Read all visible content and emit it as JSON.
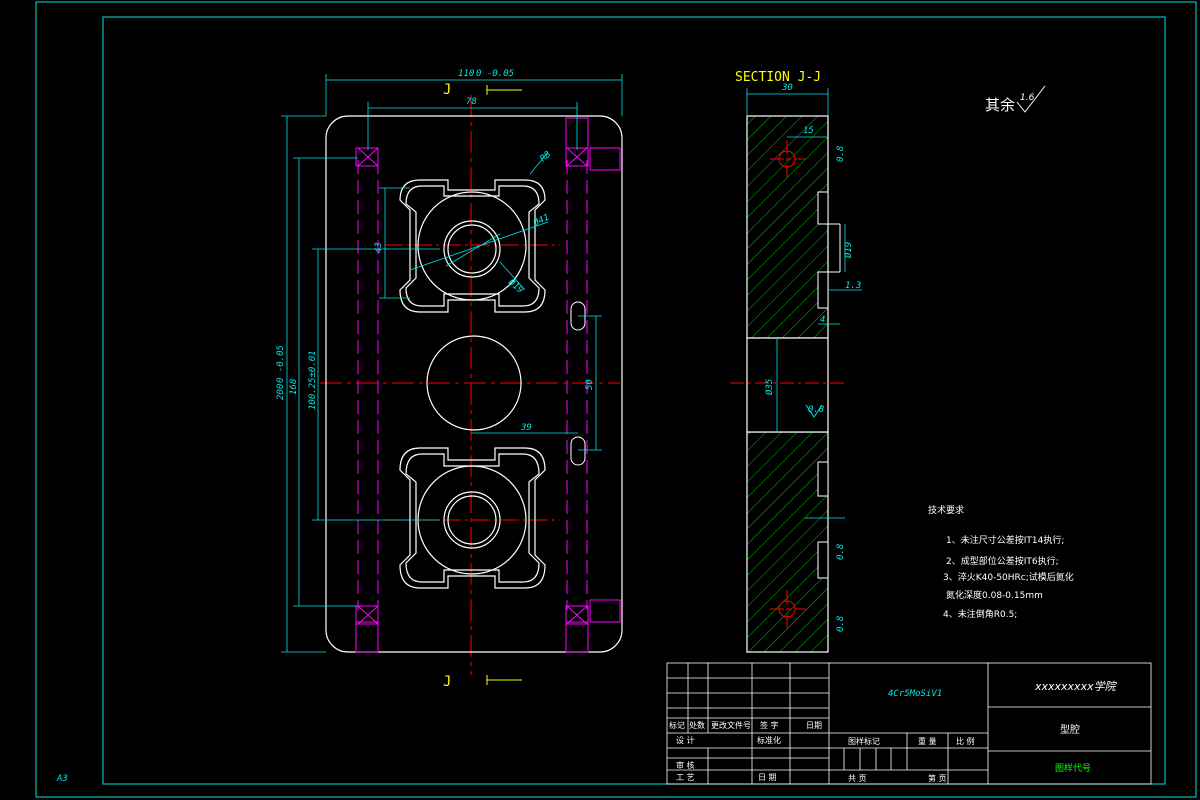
{
  "sheet": {
    "size_label": "A3"
  },
  "view": {
    "section_label_top": "J",
    "section_label_bottom": "J",
    "section_title": "SECTION  J-J"
  },
  "dimensions": {
    "overall_width": "110",
    "overall_width_tol": "0 -0.05",
    "hole_spacing": "78",
    "radius": "R8",
    "dia_41": "Ø41",
    "dia_19_front": "Ø19",
    "d43": "43",
    "overall_height": "200",
    "overall_height_tol": "0 -0.05",
    "d168": "168",
    "d100": "100.25±0.01",
    "d50": "50",
    "d39": "39",
    "sec_width": "30",
    "sec_15": "15",
    "sec_19": "Ø19",
    "sec_1_3": "1.3",
    "sec_4": "4",
    "sec_35": "Ø35",
    "rough_08": "0.8",
    "rough_16": "1.6"
  },
  "surface_finish": {
    "label": "其余",
    "value": "1.6"
  },
  "notes": {
    "title": "技术要求",
    "items": [
      "1、未注尺寸公差按IT14执行;",
      "2、成型部位公差按IT6执行;",
      "3、淬火K40-50HRc;试模后氮化",
      "氮化深度0.08-0.15mm",
      "4、未注倒角R0.5;"
    ]
  },
  "title_block": {
    "material": "4Cr5MoSiV1",
    "school": "xxxxxxxxx学院",
    "part_name": "型腔",
    "drawing_no": "图样代号",
    "row_labels": [
      "标记",
      "处数",
      "更改文件号",
      "签 字",
      "日期"
    ],
    "design": "设 计",
    "standardize": "标准化",
    "review": "审 核",
    "process": "工 艺",
    "date": "日 期",
    "stage_mark": "图样标记",
    "weight": "重 量",
    "scale": "比 例",
    "total_sheets": "共      页",
    "sheet_no": "第      页"
  },
  "colors": {
    "frame": "#00e5e5",
    "outline": "#ffffff",
    "hidden": "#ff00ff",
    "center": "#ff0000",
    "hatch": "#00c000",
    "label": "#ffff00"
  }
}
